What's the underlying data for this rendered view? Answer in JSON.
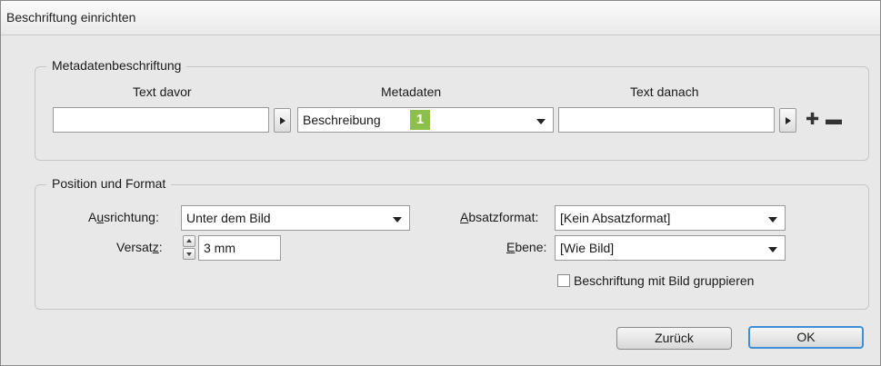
{
  "dialog": {
    "title": "Beschriftung einrichten"
  },
  "metadata_section": {
    "legend": "Metadatenbeschriftung",
    "text_before_label": "Text davor",
    "metadata_label": "Metadaten",
    "text_after_label": "Text danach",
    "text_before_value": "",
    "metadata_value": "Beschreibung",
    "badge": "1",
    "text_after_value": "",
    "add_icon": "plus-icon",
    "remove_icon": "minus-icon"
  },
  "position_section": {
    "legend": "Position und Format",
    "alignment_label": "Ausrichtung:",
    "alignment_value": "Unter dem Bild",
    "offset_label": "Versatz:",
    "offset_value": "3 mm",
    "paragraph_style_label": "Absatzformat:",
    "paragraph_style_value": "[Kein Absatzformat]",
    "layer_label": "Ebene:",
    "layer_value": "[Wie Bild]",
    "group_checkbox_label": "Beschriftung mit Bild gruppieren",
    "group_checked": false
  },
  "buttons": {
    "back": "Zurück",
    "ok": "OK"
  }
}
